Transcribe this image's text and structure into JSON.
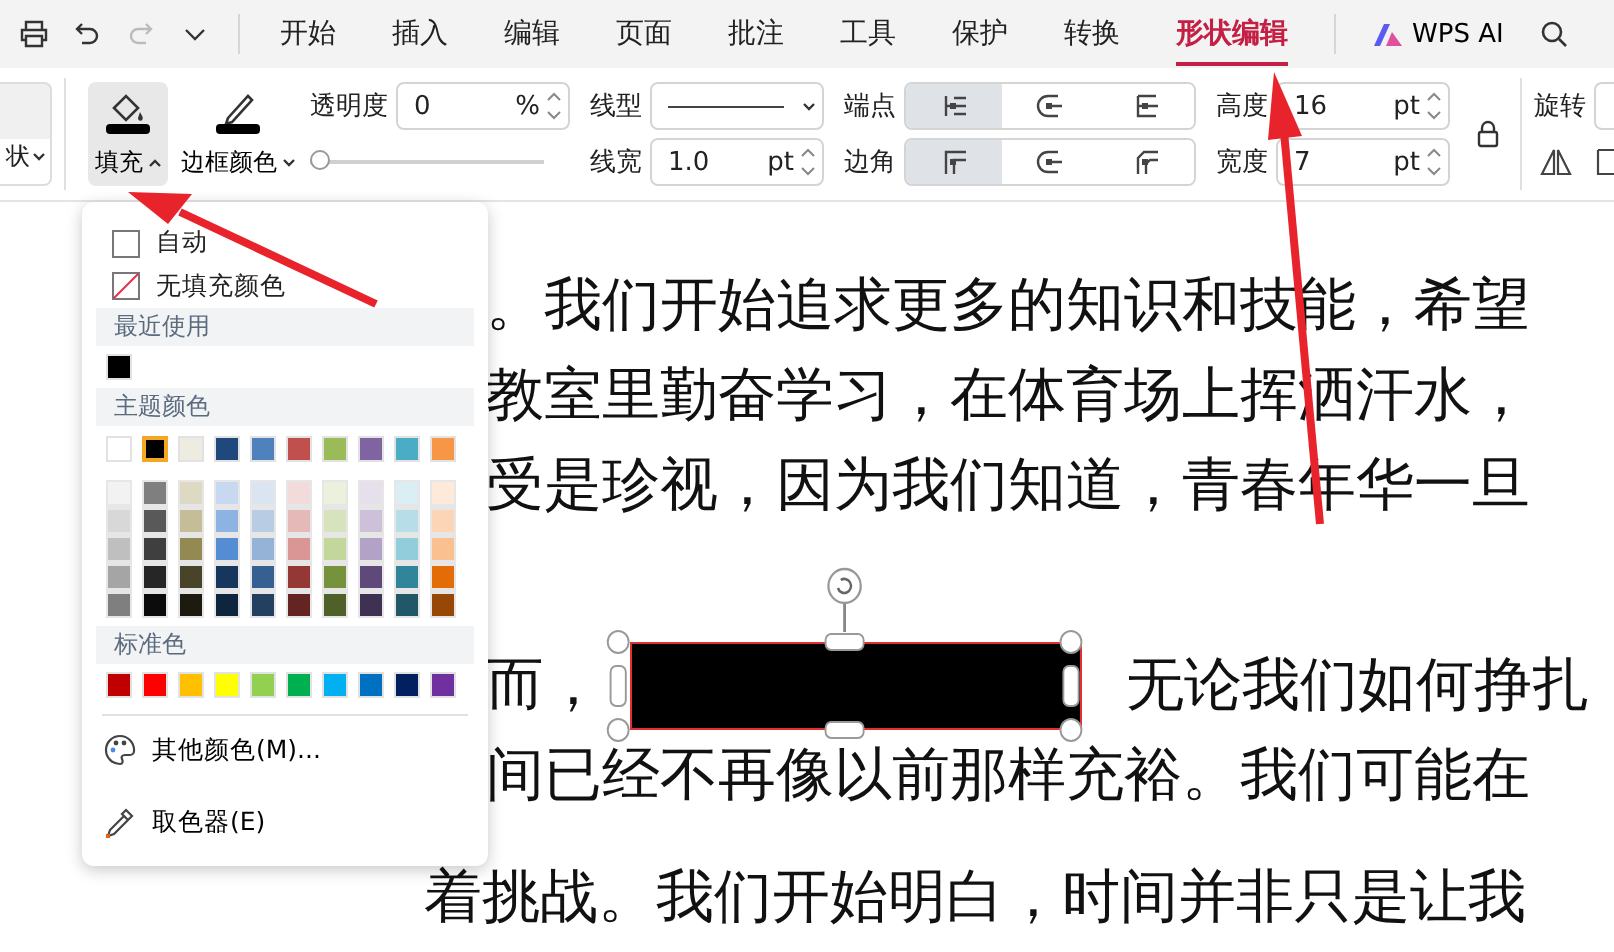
{
  "toolbar": {
    "quick_actions": [
      {
        "kind": "print",
        "disabled": false
      },
      {
        "kind": "undo",
        "disabled": false
      },
      {
        "kind": "redo",
        "disabled": true
      },
      {
        "kind": "more",
        "disabled": false
      }
    ],
    "tabs": [
      {
        "label": "开始",
        "selected": false
      },
      {
        "label": "插入",
        "selected": false
      },
      {
        "label": "编辑",
        "selected": false
      },
      {
        "label": "页面",
        "selected": false
      },
      {
        "label": "批注",
        "selected": false
      },
      {
        "label": "工具",
        "selected": false
      },
      {
        "label": "保护",
        "selected": false
      },
      {
        "label": "转换",
        "selected": false
      },
      {
        "label": "形状编辑",
        "selected": true
      }
    ],
    "ai_button": {
      "label": "WPS AI"
    }
  },
  "ribbon": {
    "gallery": {
      "label": "状"
    },
    "fill_button": {
      "label": "填充",
      "expanded": true
    },
    "border_color_button": {
      "label": "边框颜色",
      "expanded": false
    },
    "transparency": {
      "label": "透明度",
      "value": "0",
      "unit": "%"
    },
    "transparency_slider": {
      "level": 0
    },
    "line_type": {
      "label": "线型"
    },
    "line_width": {
      "label": "线宽",
      "value": "1.0",
      "unit": "pt"
    },
    "endpoints": {
      "label": "端点",
      "options": [
        {
          "kind": "flat",
          "selected": true
        },
        {
          "kind": "round",
          "selected": false
        },
        {
          "kind": "square",
          "selected": false
        }
      ]
    },
    "corners": {
      "label": "边角",
      "options": [
        {
          "kind": "miter",
          "selected": true
        },
        {
          "kind": "round",
          "selected": false
        },
        {
          "kind": "bevel",
          "selected": false
        }
      ]
    },
    "height": {
      "label": "高度",
      "value": "16",
      "unit": "pt"
    },
    "width": {
      "label": "宽度",
      "value": "7",
      "unit": "pt"
    },
    "rotate": {
      "label": "旋转"
    }
  },
  "fill_menu": {
    "auto": {
      "label": "自动",
      "checked": false
    },
    "no_fill": {
      "label": "无填充颜色"
    },
    "recent_title": "最近使用",
    "recent_colors": [
      {
        "color": "#000000",
        "selected": false
      }
    ],
    "theme_title": "主题颜色",
    "theme_colors": [
      {
        "color": "#ffffff",
        "selected": false
      },
      {
        "color": "#000000",
        "selected": true
      },
      {
        "color": "#eeece1",
        "selected": false
      },
      {
        "color": "#1f497d",
        "selected": false
      },
      {
        "color": "#4f81bd",
        "selected": false
      },
      {
        "color": "#c0504d",
        "selected": false
      },
      {
        "color": "#9bbb59",
        "selected": false
      },
      {
        "color": "#8064a2",
        "selected": false
      },
      {
        "color": "#4bacc6",
        "selected": false
      },
      {
        "color": "#f79646",
        "selected": false
      }
    ],
    "shade_columns": [
      {
        "shades": [
          {
            "color": "#f2f2f2",
            "selected": false
          },
          {
            "color": "#d8d8d8",
            "selected": false
          },
          {
            "color": "#bfbfbf",
            "selected": false
          },
          {
            "color": "#a5a5a5",
            "selected": false
          },
          {
            "color": "#7f7f7f",
            "selected": false
          }
        ]
      },
      {
        "shades": [
          {
            "color": "#7f7f7f",
            "selected": false
          },
          {
            "color": "#595959",
            "selected": false
          },
          {
            "color": "#3f3f3f",
            "selected": false
          },
          {
            "color": "#262626",
            "selected": false
          },
          {
            "color": "#0c0c0c",
            "selected": false
          }
        ]
      },
      {
        "shades": [
          {
            "color": "#ddd9c3",
            "selected": false
          },
          {
            "color": "#c4bd97",
            "selected": false
          },
          {
            "color": "#938953",
            "selected": false
          },
          {
            "color": "#494429",
            "selected": false
          },
          {
            "color": "#1d1b10",
            "selected": false
          }
        ]
      },
      {
        "shades": [
          {
            "color": "#c6d9f0",
            "selected": false
          },
          {
            "color": "#8db3e2",
            "selected": false
          },
          {
            "color": "#548dd4",
            "selected": false
          },
          {
            "color": "#17365d",
            "selected": false
          },
          {
            "color": "#0f243e",
            "selected": false
          }
        ]
      },
      {
        "shades": [
          {
            "color": "#dbe5f1",
            "selected": false
          },
          {
            "color": "#b8cce4",
            "selected": false
          },
          {
            "color": "#95b3d7",
            "selected": false
          },
          {
            "color": "#366092",
            "selected": false
          },
          {
            "color": "#244061",
            "selected": false
          }
        ]
      },
      {
        "shades": [
          {
            "color": "#f2dcdb",
            "selected": false
          },
          {
            "color": "#e5b9b7",
            "selected": false
          },
          {
            "color": "#d99694",
            "selected": false
          },
          {
            "color": "#953734",
            "selected": false
          },
          {
            "color": "#632423",
            "selected": false
          }
        ]
      },
      {
        "shades": [
          {
            "color": "#ebf1dd",
            "selected": false
          },
          {
            "color": "#d7e3bc",
            "selected": false
          },
          {
            "color": "#c3d69b",
            "selected": false
          },
          {
            "color": "#76923c",
            "selected": false
          },
          {
            "color": "#4f6128",
            "selected": false
          }
        ]
      },
      {
        "shades": [
          {
            "color": "#e5e0ec",
            "selected": false
          },
          {
            "color": "#ccc1d9",
            "selected": false
          },
          {
            "color": "#b2a2c7",
            "selected": false
          },
          {
            "color": "#5f497a",
            "selected": false
          },
          {
            "color": "#3f3151",
            "selected": false
          }
        ]
      },
      {
        "shades": [
          {
            "color": "#dbeef3",
            "selected": false
          },
          {
            "color": "#b7dde8",
            "selected": false
          },
          {
            "color": "#92cddc",
            "selected": false
          },
          {
            "color": "#31859b",
            "selected": false
          },
          {
            "color": "#205867",
            "selected": false
          }
        ]
      },
      {
        "shades": [
          {
            "color": "#fdeada",
            "selected": false
          },
          {
            "color": "#fbd5b5",
            "selected": false
          },
          {
            "color": "#fac08f",
            "selected": false
          },
          {
            "color": "#e36c09",
            "selected": false
          },
          {
            "color": "#974806",
            "selected": false
          }
        ]
      }
    ],
    "standard_title": "标准色",
    "standard_colors": [
      {
        "color": "#c00000",
        "selected": false
      },
      {
        "color": "#ff0000",
        "selected": false
      },
      {
        "color": "#ffc000",
        "selected": false
      },
      {
        "color": "#ffff00",
        "selected": false
      },
      {
        "color": "#92d050",
        "selected": false
      },
      {
        "color": "#00b050",
        "selected": false
      },
      {
        "color": "#00b0f0",
        "selected": false
      },
      {
        "color": "#0070c0",
        "selected": false
      },
      {
        "color": "#002060",
        "selected": false
      },
      {
        "color": "#7030a0",
        "selected": false
      }
    ],
    "more_colors": "其他颜色(M)...",
    "eyedropper": "取色器(E)"
  },
  "document": {
    "lines": [
      {
        "kind": "text",
        "text": "。我们开始追求更多的知识和技能，希望"
      },
      {
        "kind": "text",
        "text": "教室里勤奋学习，在体育场上挥洒汗水，"
      },
      {
        "kind": "text",
        "text": "受是珍视，因为我们知道，青春年华一旦"
      },
      {
        "kind": "shape",
        "before": "而，",
        "after": "无论我们如何挣扎",
        "selected": true
      },
      {
        "kind": "text",
        "text": "间已经不再像以前那样充裕。我们可能在"
      },
      {
        "kind": "text",
        "text": "着挑战。我们开始明白，时间并非只是让我"
      }
    ]
  }
}
